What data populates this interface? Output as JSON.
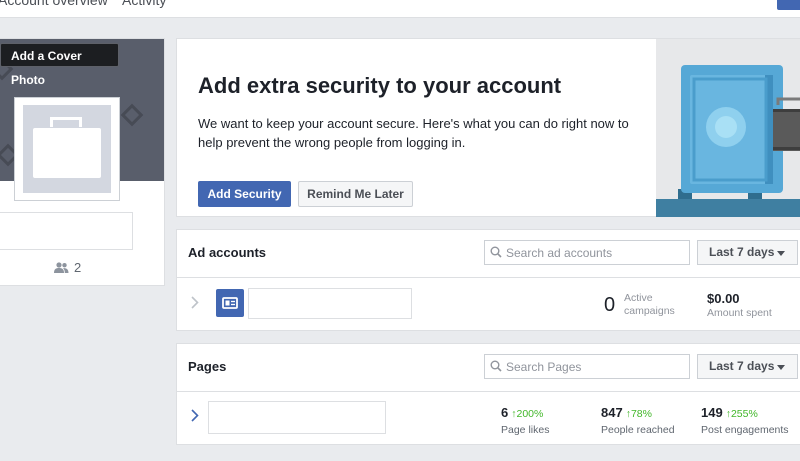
{
  "top_tabs": [
    "Account overview",
    "Activity"
  ],
  "profile": {
    "add_cover_label": "Add a Cover Photo",
    "friends_count": "2"
  },
  "security": {
    "title": "Add extra security to your account",
    "description": "We want to keep your account secure. Here's what you can do right now to help prevent the wrong people from logging in.",
    "add_button": "Add Security",
    "remind_button": "Remind Me Later"
  },
  "ad_accounts": {
    "title": "Ad accounts",
    "search_placeholder": "Search ad accounts",
    "range": "Last 7 days",
    "active_count": "0",
    "active_label_1": "Active",
    "active_label_2": "campaigns",
    "amount": "$0.00",
    "amount_label": "Amount spent"
  },
  "pages": {
    "title": "Pages",
    "search_placeholder": "Search Pages",
    "range": "Last 7 days",
    "stats": [
      {
        "value": "6",
        "change": "200%",
        "label": "Page likes"
      },
      {
        "value": "847",
        "change": "78%",
        "label": "People reached"
      },
      {
        "value": "149",
        "change": "255%",
        "label": "Post engagements"
      }
    ]
  },
  "colors": {
    "brand_blue": "#4267b2",
    "positive_green": "#42b72a",
    "safe_blue": "#56a8d6"
  },
  "icons": [
    "people-icon",
    "search-icon",
    "chevron-right-icon",
    "caret-down-icon",
    "ad-account-icon",
    "arrow-up-icon",
    "briefcase-icon",
    "safe-icon"
  ]
}
